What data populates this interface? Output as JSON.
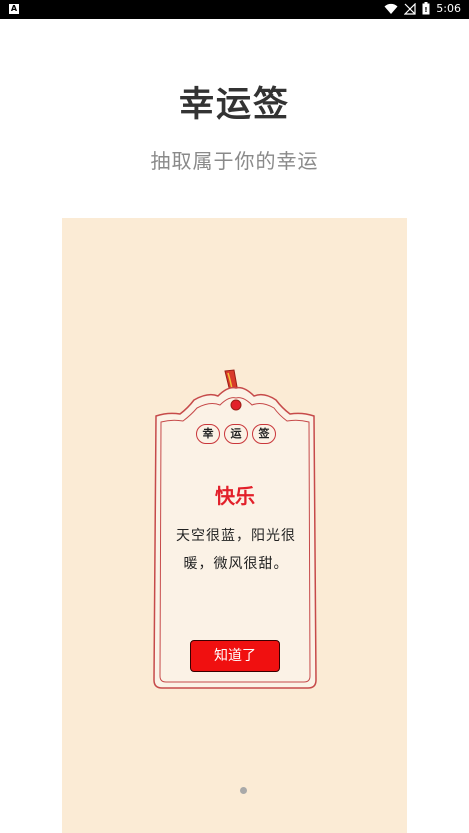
{
  "status_bar": {
    "time": "5:06",
    "app_icon_letter": "A"
  },
  "header": {
    "title": "幸运签",
    "subtitle": "抽取属于你的幸运"
  },
  "card": {
    "badges": [
      "幸",
      "运",
      "签"
    ],
    "fortune_title": "快乐",
    "fortune_text": "天空很蓝，阳光很暖，微风很甜。",
    "button_label": "知道了"
  },
  "pager": {
    "count": 2,
    "active_index": 1
  },
  "colors": {
    "banner_bg": "#fbebd5",
    "accent_red": "#e2202a",
    "button_red": "#f01010",
    "title_text": "#333333",
    "subtitle_text": "#8a8a8a"
  }
}
